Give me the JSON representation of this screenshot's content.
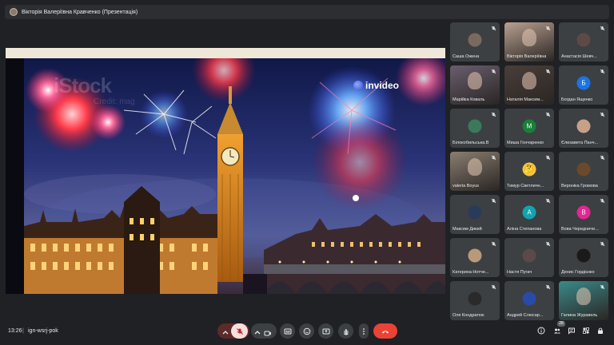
{
  "meeting": {
    "presenter_title": "Вікторія Валеріївна Кравченко (Презентація)",
    "time": "13:26",
    "separator": "|",
    "code": "ign-wsrj-pok",
    "participant_count": "28"
  },
  "slide": {
    "watermark": "iStock",
    "watermark_sub": "Credit: mag",
    "brand": "invideo"
  },
  "participants": [
    {
      "name": "Саша Ожена",
      "kind": "photo",
      "color": "#7a6a5e"
    },
    {
      "name": "Вікторія Валеріївна",
      "kind": "video",
      "color": "#b8a090"
    },
    {
      "name": "Анастасія Шевч...",
      "kind": "photo",
      "color": "#5e4a44"
    },
    {
      "name": "Марійка Коваль",
      "kind": "video",
      "color": "#6a5e6e"
    },
    {
      "name": "Наталія Максим...",
      "kind": "video",
      "color": "#4a3e3a"
    },
    {
      "name": "Богдан Ященко",
      "kind": "letter",
      "letter": "Б",
      "color": "#1a73e8"
    },
    {
      "name": "Білокобильська.В",
      "kind": "photo",
      "color": "#3a7a5a"
    },
    {
      "name": "Миша Гончаренко",
      "kind": "letter",
      "letter": "М",
      "color": "#188038"
    },
    {
      "name": "Єлизавета Панч...",
      "kind": "photo",
      "color": "#c8a08a"
    },
    {
      "name": "valeria Boyus",
      "kind": "video",
      "color": "#8a7e70"
    },
    {
      "name": "Тимур Светличн...",
      "kind": "emoji",
      "emoji": "🤔",
      "color": "#3c4043"
    },
    {
      "name": "Вероніка Громова",
      "kind": "photo",
      "color": "#6a4a2a"
    },
    {
      "name": "Максим Дикий",
      "kind": "photo",
      "color": "#2a3a5a"
    },
    {
      "name": "Аліна Степанова",
      "kind": "letter",
      "letter": "А",
      "color": "#12a4af"
    },
    {
      "name": "Вова Чередниче...",
      "kind": "letter",
      "letter": "В",
      "color": "#e52592"
    },
    {
      "name": "Катерина Нотче...",
      "kind": "photo",
      "color": "#b89a7a"
    },
    {
      "name": "Настя Пугач",
      "kind": "photo",
      "color": "#5a4a4a"
    },
    {
      "name": "Денис Гордієнко",
      "kind": "photo",
      "color": "#1a1a1a"
    },
    {
      "name": "Оля Кондратюк",
      "kind": "photo",
      "color": "#2a2a2a"
    },
    {
      "name": "Андрей Слюсар...",
      "kind": "photo",
      "color": "#2a4aa8"
    },
    {
      "name": "Галина Журавель",
      "kind": "video",
      "color": "#3a8a8a"
    }
  ],
  "controls": {
    "end_call_color": "#ea4335",
    "mic_off_color": "#f9dedc",
    "icons": [
      "chevron-up-icon",
      "mic-off-icon",
      "chevron-up-icon",
      "camera-icon",
      "captions-icon",
      "emoji-icon",
      "present-icon",
      "raise-hand-icon",
      "more-icon",
      "end-call-icon"
    ],
    "right_icons": [
      "info-icon",
      "people-icon",
      "chat-icon",
      "activities-icon",
      "lock-icon"
    ]
  }
}
